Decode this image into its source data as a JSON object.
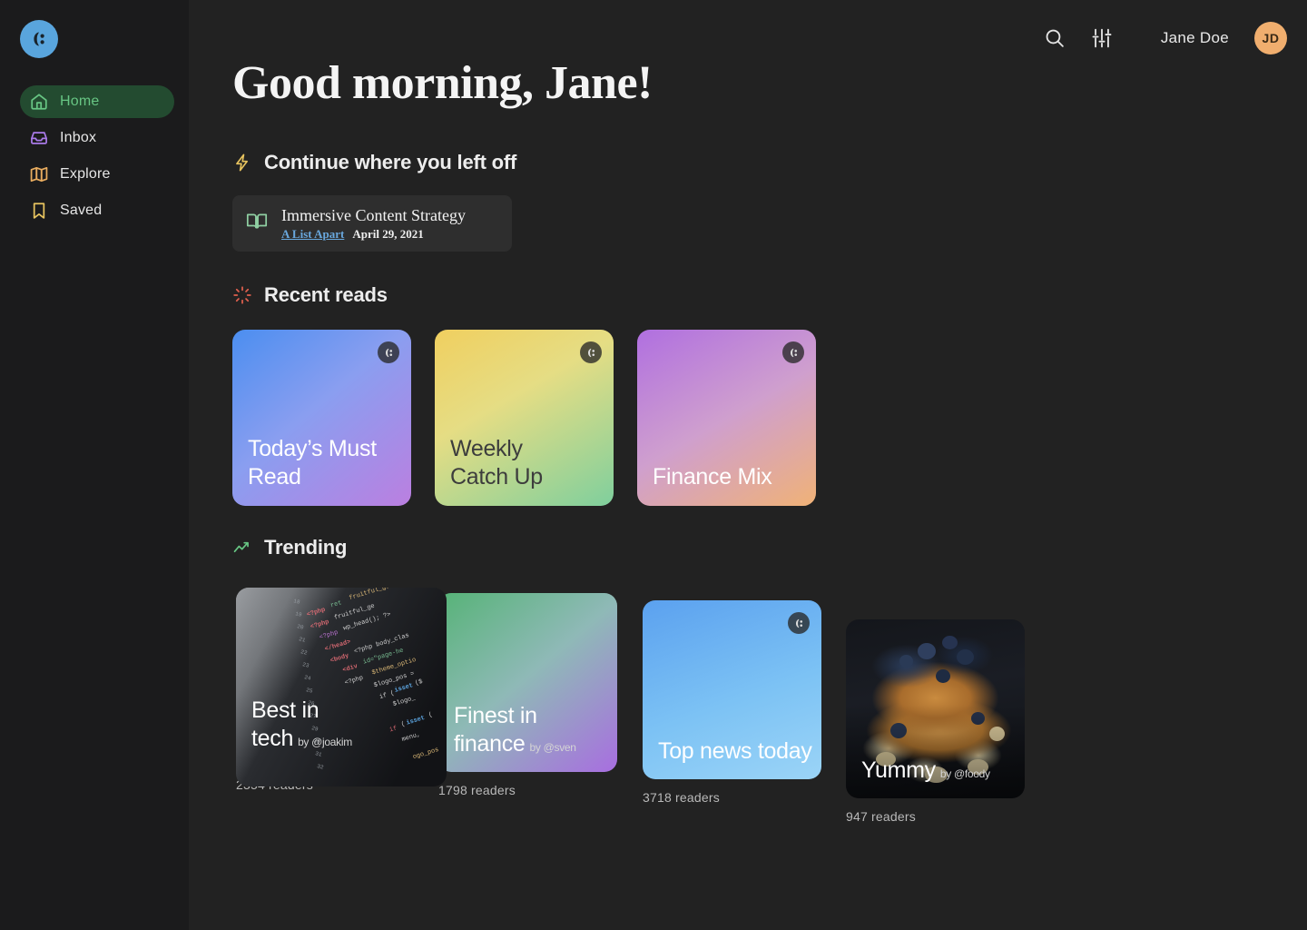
{
  "brand": {
    "logo_icon": "app-logo-icon",
    "logo_color": "#59a5dd"
  },
  "sidebar": {
    "items": [
      {
        "label": "Home",
        "icon": "home-icon",
        "active": true,
        "color": "#67c583"
      },
      {
        "label": "Inbox",
        "icon": "inbox-icon",
        "active": false,
        "color": "#a97ae8"
      },
      {
        "label": "Explore",
        "icon": "map-icon",
        "active": false,
        "color": "#e8ac5f"
      },
      {
        "label": "Saved",
        "icon": "bookmark-icon",
        "active": false,
        "color": "#e8c45f"
      }
    ],
    "active_bg": "#234b30"
  },
  "topbar": {
    "search_icon": "search-icon",
    "settings_icon": "sliders-icon",
    "user_name": "Jane Doe",
    "avatar_initials": "JD",
    "avatar_color": "#f0ae6e"
  },
  "main": {
    "greeting": "Good morning, Jane!",
    "sections": {
      "continue": {
        "icon": "lightning-bolt-icon",
        "title": "Continue where you left off",
        "card": {
          "icon": "open-book-icon",
          "title": "Immersive Content Strategy",
          "source": "A List Apart",
          "date": "April 29, 2021"
        }
      },
      "recent": {
        "icon": "sparkle-burst-icon",
        "title": "Recent reads",
        "cards": [
          {
            "title": "Today’s Must Read",
            "badge": "app-logo-icon",
            "title_color": "#ffffff"
          },
          {
            "title": "Weekly Catch Up",
            "badge": "app-logo-icon",
            "title_color": "#3d3d3d"
          },
          {
            "title": "Finance Mix",
            "badge": "app-logo-icon",
            "title_color": "#ffffff"
          }
        ]
      },
      "trending": {
        "icon": "trending-up-icon",
        "title": "Trending",
        "cards": [
          {
            "title": "Best in tech",
            "byline": "by @joakim",
            "readers": "2354 readers",
            "badge": ""
          },
          {
            "title": "Finest in finance",
            "byline": "by @sven",
            "readers": "1798 readers",
            "badge": ""
          },
          {
            "title": "Top news today",
            "byline": "",
            "readers": "3718 readers",
            "badge": "app-logo-icon"
          },
          {
            "title": "Yummy",
            "byline": "by @foody",
            "readers": "947 readers",
            "badge": ""
          }
        ]
      }
    }
  }
}
